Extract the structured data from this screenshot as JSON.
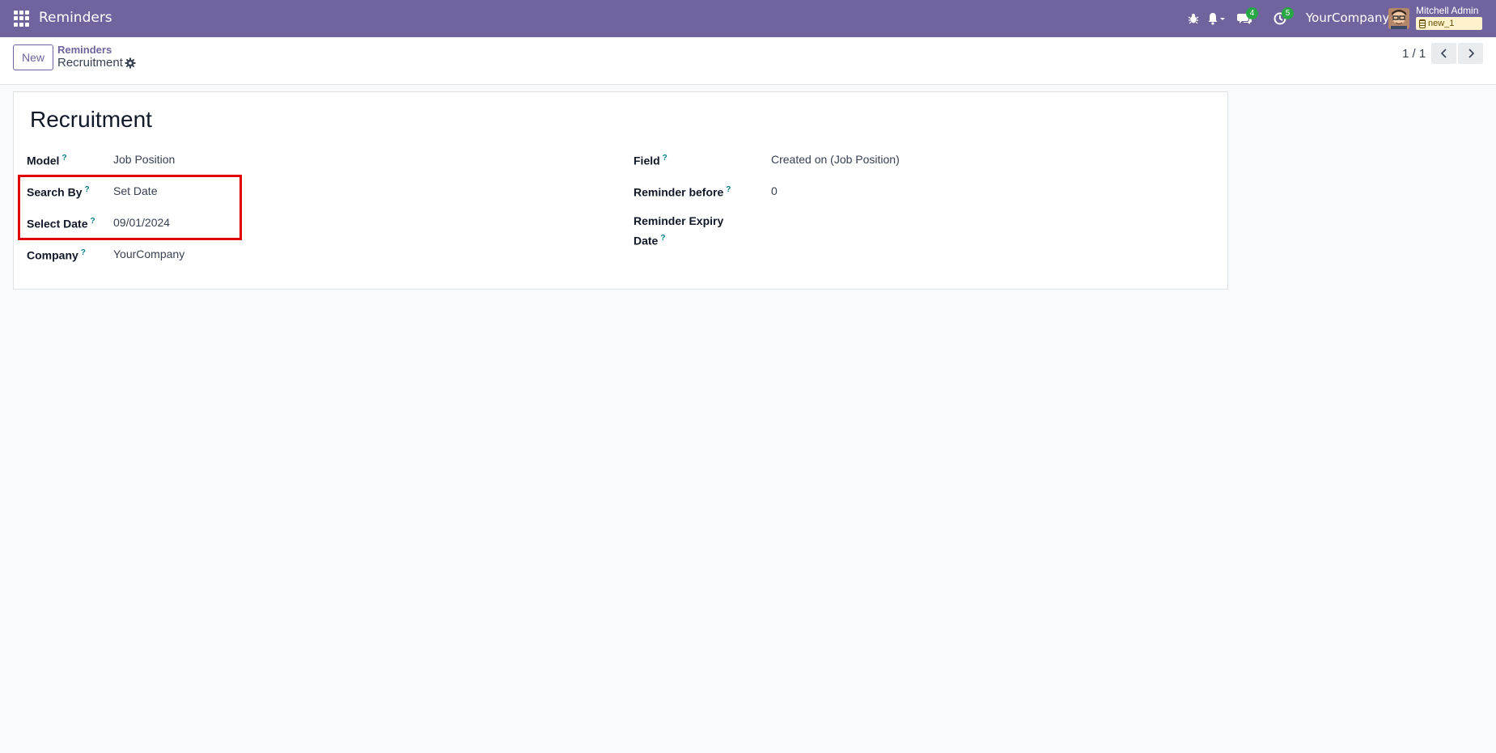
{
  "app": {
    "title": "Reminders"
  },
  "topbar": {
    "messages_count": "4",
    "activities_count": "5",
    "company": "YourCompany",
    "user_name": "Mitchell Admin",
    "db_name": "new_1"
  },
  "controls": {
    "new_label": "New",
    "breadcrumb_parent": "Reminders",
    "breadcrumb_current": "Recruitment",
    "pager": "1 / 1"
  },
  "record": {
    "title": "Recruitment",
    "fields_left": [
      {
        "label": "Model",
        "value": "Job Position"
      },
      {
        "label": "Search By",
        "value": "Set Date"
      },
      {
        "label": "Select Date",
        "value": "09/01/2024"
      },
      {
        "label": "Company",
        "value": "YourCompany"
      }
    ],
    "fields_right": [
      {
        "label": "Field",
        "value": "Created on (Job Position)"
      },
      {
        "label": "Reminder before",
        "value": "0"
      },
      {
        "label_line1": "Reminder Expiry",
        "label_line2": "Date",
        "value": ""
      }
    ]
  },
  "colors": {
    "brand": "#71639e",
    "highlight": "#e00000",
    "badge": "#28a745",
    "help": "#017e84"
  }
}
